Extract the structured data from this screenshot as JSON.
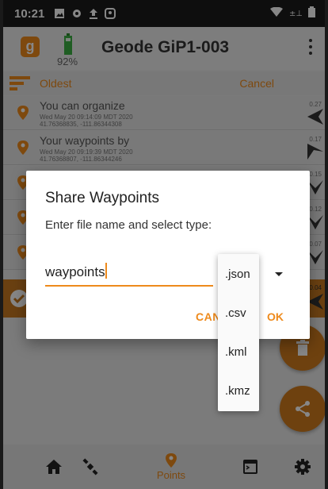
{
  "status_bar": {
    "time": "10:21"
  },
  "app_bar": {
    "title": "Geode GiP1-003",
    "battery_percent": "92%",
    "logo_letter": "g",
    "menu_icon": "more-vert-icon"
  },
  "list_header": {
    "sort_label": "Oldest",
    "cancel_label": "Cancel"
  },
  "waypoints": [
    {
      "name": "You can organize",
      "date": "Wed May 20 09:14:09 MDT 2020",
      "coords": "41.76368835, -111.86344308",
      "distance": "0.27"
    },
    {
      "name": "Your waypoints by",
      "date": "Wed May 20 09:19:39 MDT 2020",
      "coords": "41.76368807, -111.86344246",
      "distance": "0.17"
    }
  ],
  "hidden_row_distances": [
    "0.15",
    "0.12",
    "0.07",
    "0.04"
  ],
  "dialog": {
    "title": "Share Waypoints",
    "message": "Enter file name and select type:",
    "filename_value": "waypoints",
    "cancel_label": "CAN",
    "ok_label": "OK"
  },
  "file_types": [
    ".json",
    ".csv",
    ".kml",
    ".kmz"
  ],
  "bottom_nav": {
    "points_label": "Points"
  },
  "colors": {
    "accent": "#ee8a1c",
    "scrim": "rgba(0,0,0,0.47)"
  }
}
